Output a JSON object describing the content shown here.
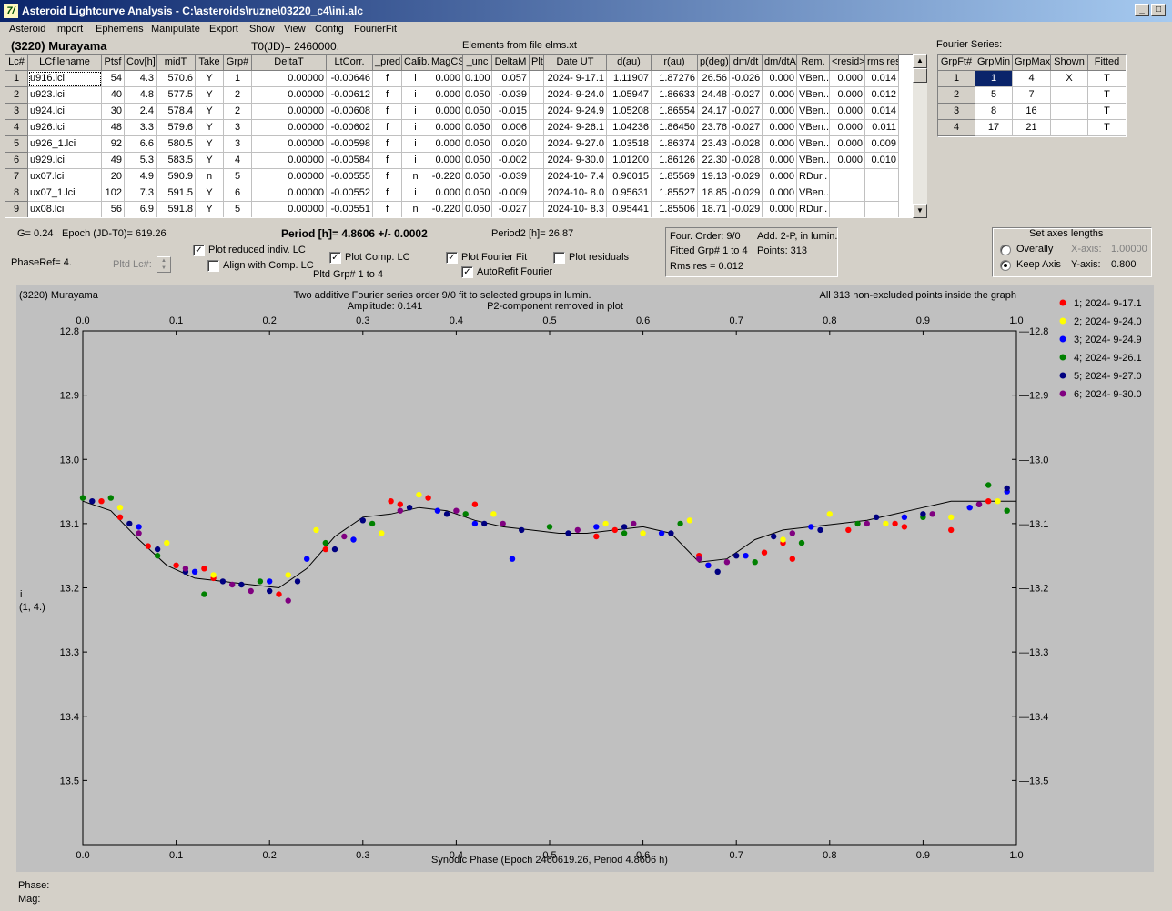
{
  "window": {
    "title": "Asteroid Lightcurve Analysis - C:\\asteroids\\ruzne\\03220_c4\\ini.alc",
    "icon_text": "7/",
    "buttons": [
      "_",
      "□",
      "✕"
    ]
  },
  "menu": [
    "Asteroid",
    "Import",
    "Ephemeris",
    "Manipulate",
    "Export",
    "Show",
    "View",
    "Config",
    "FourierFit"
  ],
  "header": {
    "asteroid_name": "(3220) Murayama",
    "t0": "T0(JD)= 2460000.",
    "elements": "Elements from file elms.xt",
    "fourier_series_label": "Fourier Series:"
  },
  "lc_table": {
    "columns": [
      "Lc#",
      "LCfilename",
      "Ptsf",
      "Cov[h]",
      "midT",
      "Take",
      "Grp#",
      "DeltaT",
      "LtCorr.",
      "_pred.",
      "Calib.",
      "MagCS",
      "_unc",
      "DeltaM",
      "Plt",
      "Date UT",
      "d(au)",
      "r(au)",
      "p(deg)",
      "dm/dt",
      "dm/dtA",
      "Rem.",
      "<resid>",
      "rms res"
    ],
    "rows": [
      [
        "1",
        "u916.lci",
        "54",
        "4.3",
        "570.6",
        "Y",
        "1",
        "0.00000",
        "-0.00646",
        "f",
        "i",
        "0.000",
        "0.100",
        "0.057",
        "",
        "2024- 9-17.1",
        "1.11907",
        "1.87276",
        "26.56",
        "-0.026",
        "0.000",
        "VBen..",
        "0.000",
        "0.014"
      ],
      [
        "2",
        "u923.lci",
        "40",
        "4.8",
        "577.5",
        "Y",
        "2",
        "0.00000",
        "-0.00612",
        "f",
        "i",
        "0.000",
        "0.050",
        "-0.039",
        "",
        "2024- 9-24.0",
        "1.05947",
        "1.86633",
        "24.48",
        "-0.027",
        "0.000",
        "VBen..",
        "0.000",
        "0.012"
      ],
      [
        "3",
        "u924.lci",
        "30",
        "2.4",
        "578.4",
        "Y",
        "2",
        "0.00000",
        "-0.00608",
        "f",
        "i",
        "0.000",
        "0.050",
        "-0.015",
        "",
        "2024- 9-24.9",
        "1.05208",
        "1.86554",
        "24.17",
        "-0.027",
        "0.000",
        "VBen..",
        "0.000",
        "0.014"
      ],
      [
        "4",
        "u926.lci",
        "48",
        "3.3",
        "579.6",
        "Y",
        "3",
        "0.00000",
        "-0.00602",
        "f",
        "i",
        "0.000",
        "0.050",
        "0.006",
        "",
        "2024- 9-26.1",
        "1.04236",
        "1.86450",
        "23.76",
        "-0.027",
        "0.000",
        "VBen..",
        "0.000",
        "0.011"
      ],
      [
        "5",
        "u926_1.lci",
        "92",
        "6.6",
        "580.5",
        "Y",
        "3",
        "0.00000",
        "-0.00598",
        "f",
        "i",
        "0.000",
        "0.050",
        "0.020",
        "",
        "2024- 9-27.0",
        "1.03518",
        "1.86374",
        "23.43",
        "-0.028",
        "0.000",
        "VBen..",
        "0.000",
        "0.009"
      ],
      [
        "6",
        "u929.lci",
        "49",
        "5.3",
        "583.5",
        "Y",
        "4",
        "0.00000",
        "-0.00584",
        "f",
        "i",
        "0.000",
        "0.050",
        "-0.002",
        "",
        "2024- 9-30.0",
        "1.01200",
        "1.86126",
        "22.30",
        "-0.028",
        "0.000",
        "VBen..",
        "0.000",
        "0.010"
      ],
      [
        "7",
        "ux07.lci",
        "20",
        "4.9",
        "590.9",
        "n",
        "5",
        "0.00000",
        "-0.00555",
        "f",
        "n",
        "-0.220",
        "0.050",
        "-0.039",
        "",
        "2024-10- 7.4",
        "0.96015",
        "1.85569",
        "19.13",
        "-0.029",
        "0.000",
        "RDur..",
        "",
        ""
      ],
      [
        "8",
        "ux07_1.lci",
        "102",
        "7.3",
        "591.5",
        "Y",
        "6",
        "0.00000",
        "-0.00552",
        "f",
        "i",
        "0.000",
        "0.050",
        "-0.009",
        "",
        "2024-10- 8.0",
        "0.95631",
        "1.85527",
        "18.85",
        "-0.029",
        "0.000",
        "VBen..",
        "",
        ""
      ],
      [
        "9",
        "ux08.lci",
        "56",
        "6.9",
        "591.8",
        "Y",
        "5",
        "0.00000",
        "-0.00551",
        "f",
        "n",
        "-0.220",
        "0.050",
        "-0.027",
        "",
        "2024-10- 8.3",
        "0.95441",
        "1.85506",
        "18.71",
        "-0.029",
        "0.000",
        "RDur..",
        "",
        ""
      ]
    ]
  },
  "fourier_table": {
    "columns": [
      "GrpFt#",
      "GrpMin",
      "GrpMax",
      "Shown",
      "Fitted"
    ],
    "rows": [
      [
        "1",
        "1",
        "4",
        "X",
        "T"
      ],
      [
        "2",
        "5",
        "7",
        "",
        "T"
      ],
      [
        "3",
        "8",
        "16",
        "",
        "T"
      ],
      [
        "4",
        "17",
        "21",
        "",
        "T"
      ]
    ]
  },
  "controls": {
    "g": "G= 0.24",
    "epoch": "Epoch (JD-T0)= 619.26",
    "period": "Period [h]= 4.8606 +/- 0.0002",
    "period2": "Period2 [h]= 26.87",
    "phase_ref": "PhaseRef= 4.",
    "pltd_lc": "Pltd Lc#:",
    "plot_reduced": "Plot reduced indiv. LC",
    "align_comp": "Align with Comp. LC",
    "plot_comp": "Plot Comp. LC",
    "pltd_grp": "Pltd Grp#  1   to   4",
    "plot_fourier": "Plot Fourier Fit",
    "autorefit": "AutoRefit Fourier",
    "plot_residuals": "Plot residuals",
    "check_states": {
      "plot_reduced": true,
      "align_comp": false,
      "plot_comp": true,
      "plot_fourier": true,
      "autorefit": true,
      "plot_residuals": false
    }
  },
  "fit_info": {
    "four_order": "Four. Order:  9/0",
    "add": "Add. 2-P, in lumin.",
    "fitted_grp": "Fitted Grp# 1 to 4",
    "points": "Points: 313",
    "rms": "Rms res      = 0.012"
  },
  "axes_box": {
    "title": "Set axes lengths",
    "overall": "Overally",
    "keep": "Keep Axis",
    "xaxis_label": "X-axis:",
    "xaxis_value": "1.00000",
    "yaxis_label": "Y-axis:",
    "yaxis_value": "0.800",
    "selected": "keep"
  },
  "plot": {
    "top_left": "(3220) Murayama",
    "top_center1": "Two additive Fourier series order 9/0 fit to selected groups in lumin.",
    "top_center2a": "Amplitude: 0.141",
    "top_center2b": "P2-component removed in plot",
    "top_right": "All 313 non-excluded points inside the graph",
    "ylabel1": "i",
    "ylabel2": "(1, 4.)",
    "xlabel": "Synodic Phase (Epoch 2460619.26, Period 4.8606 h)",
    "legend": [
      {
        "label": "1; 2024- 9-17.1",
        "color": "#ff0000"
      },
      {
        "label": "2; 2024- 9-24.0",
        "color": "#ffff00"
      },
      {
        "label": "3; 2024- 9-24.9",
        "color": "#0000ff"
      },
      {
        "label": "4; 2024- 9-26.1",
        "color": "#008000"
      },
      {
        "label": "5; 2024- 9-27.0",
        "color": "#000080"
      },
      {
        "label": "6; 2024- 9-30.0",
        "color": "#800080"
      }
    ]
  },
  "status": {
    "phase": "Phase:",
    "mag": "Mag:"
  },
  "chart_data": {
    "type": "scatter",
    "xlabel": "Synodic Phase (Epoch 2460619.26, Period 4.8606 h)",
    "ylabel": "i (1, 4.)",
    "xlim": [
      0.0,
      1.0
    ],
    "ylim": [
      13.6,
      12.8
    ],
    "x_ticks": [
      "0.0",
      "0.1",
      "0.2",
      "0.3",
      "0.4",
      "0.5",
      "0.6",
      "0.7",
      "0.8",
      "0.9",
      "1.0"
    ],
    "y_ticks": [
      "12.8",
      "12.9",
      "13.0",
      "13.1",
      "13.2",
      "13.3",
      "13.4",
      "13.5"
    ],
    "fourier_curve": {
      "x": [
        0.0,
        0.03,
        0.06,
        0.09,
        0.12,
        0.15,
        0.18,
        0.21,
        0.24,
        0.27,
        0.3,
        0.33,
        0.36,
        0.39,
        0.42,
        0.45,
        0.48,
        0.51,
        0.54,
        0.57,
        0.6,
        0.63,
        0.66,
        0.69,
        0.72,
        0.75,
        0.78,
        0.81,
        0.84,
        0.87,
        0.9,
        0.93,
        0.96,
        1.0
      ],
      "y": [
        13.065,
        13.08,
        13.125,
        13.165,
        13.185,
        13.19,
        13.195,
        13.2,
        13.17,
        13.12,
        13.09,
        13.085,
        13.075,
        13.08,
        13.095,
        13.105,
        13.11,
        13.115,
        13.115,
        13.11,
        13.105,
        13.115,
        13.16,
        13.155,
        13.125,
        13.11,
        13.105,
        13.1,
        13.095,
        13.085,
        13.075,
        13.065,
        13.065,
        13.065
      ]
    },
    "series": [
      {
        "name": "1; 2024- 9-17.1",
        "color": "#ff0000",
        "x": [
          0.02,
          0.04,
          0.07,
          0.1,
          0.13,
          0.14,
          0.21,
          0.26,
          0.33,
          0.34,
          0.37,
          0.42,
          0.55,
          0.57,
          0.66,
          0.67,
          0.73,
          0.75,
          0.76,
          0.82,
          0.87,
          0.88,
          0.93,
          0.97
        ],
        "y": [
          13.065,
          13.09,
          13.135,
          13.165,
          13.17,
          13.185,
          13.21,
          13.14,
          13.065,
          13.07,
          13.06,
          13.07,
          13.12,
          13.11,
          13.15,
          13.165,
          13.145,
          13.13,
          13.155,
          13.11,
          13.1,
          13.105,
          13.11,
          13.065
        ]
      },
      {
        "name": "2; 2024- 9-24.0",
        "color": "#ffff00",
        "x": [
          0.04,
          0.09,
          0.14,
          0.22,
          0.25,
          0.32,
          0.36,
          0.44,
          0.56,
          0.6,
          0.65,
          0.75,
          0.8,
          0.86,
          0.93,
          0.98
        ],
        "y": [
          13.075,
          13.13,
          13.18,
          13.18,
          13.11,
          13.115,
          13.055,
          13.085,
          13.1,
          13.115,
          13.095,
          13.125,
          13.085,
          13.1,
          13.09,
          13.065
        ]
      },
      {
        "name": "3; 2024- 9-24.9",
        "color": "#0000ff",
        "x": [
          0.06,
          0.12,
          0.2,
          0.24,
          0.29,
          0.38,
          0.42,
          0.46,
          0.55,
          0.62,
          0.67,
          0.71,
          0.78,
          0.88,
          0.95,
          0.99
        ],
        "y": [
          13.105,
          13.175,
          13.19,
          13.155,
          13.125,
          13.08,
          13.1,
          13.155,
          13.105,
          13.115,
          13.165,
          13.15,
          13.105,
          13.09,
          13.075,
          13.05
        ]
      },
      {
        "name": "4; 2024- 9-26.1",
        "color": "#008000",
        "x": [
          0.0,
          0.03,
          0.08,
          0.13,
          0.19,
          0.26,
          0.31,
          0.41,
          0.5,
          0.58,
          0.64,
          0.72,
          0.77,
          0.83,
          0.9,
          0.97,
          0.99
        ],
        "y": [
          13.06,
          13.06,
          13.15,
          13.21,
          13.19,
          13.13,
          13.1,
          13.085,
          13.105,
          13.115,
          13.1,
          13.16,
          13.13,
          13.1,
          13.09,
          13.04,
          13.08
        ]
      },
      {
        "name": "5; 2024- 9-27.0",
        "color": "#000080",
        "x": [
          0.01,
          0.05,
          0.08,
          0.11,
          0.15,
          0.17,
          0.2,
          0.23,
          0.27,
          0.3,
          0.35,
          0.39,
          0.43,
          0.47,
          0.52,
          0.58,
          0.63,
          0.68,
          0.7,
          0.74,
          0.79,
          0.85,
          0.9,
          0.96,
          0.99
        ],
        "y": [
          13.065,
          13.1,
          13.14,
          13.175,
          13.19,
          13.195,
          13.205,
          13.19,
          13.14,
          13.095,
          13.075,
          13.085,
          13.1,
          13.11,
          13.115,
          13.105,
          13.115,
          13.175,
          13.15,
          13.12,
          13.11,
          13.09,
          13.085,
          13.07,
          13.045
        ]
      },
      {
        "name": "6; 2024- 9-30.0",
        "color": "#800080",
        "x": [
          0.06,
          0.11,
          0.16,
          0.18,
          0.22,
          0.28,
          0.34,
          0.4,
          0.45,
          0.53,
          0.59,
          0.66,
          0.69,
          0.76,
          0.84,
          0.91,
          0.96
        ],
        "y": [
          13.115,
          13.17,
          13.195,
          13.205,
          13.22,
          13.12,
          13.08,
          13.08,
          13.1,
          13.11,
          13.1,
          13.155,
          13.16,
          13.115,
          13.1,
          13.085,
          13.07
        ]
      }
    ]
  }
}
